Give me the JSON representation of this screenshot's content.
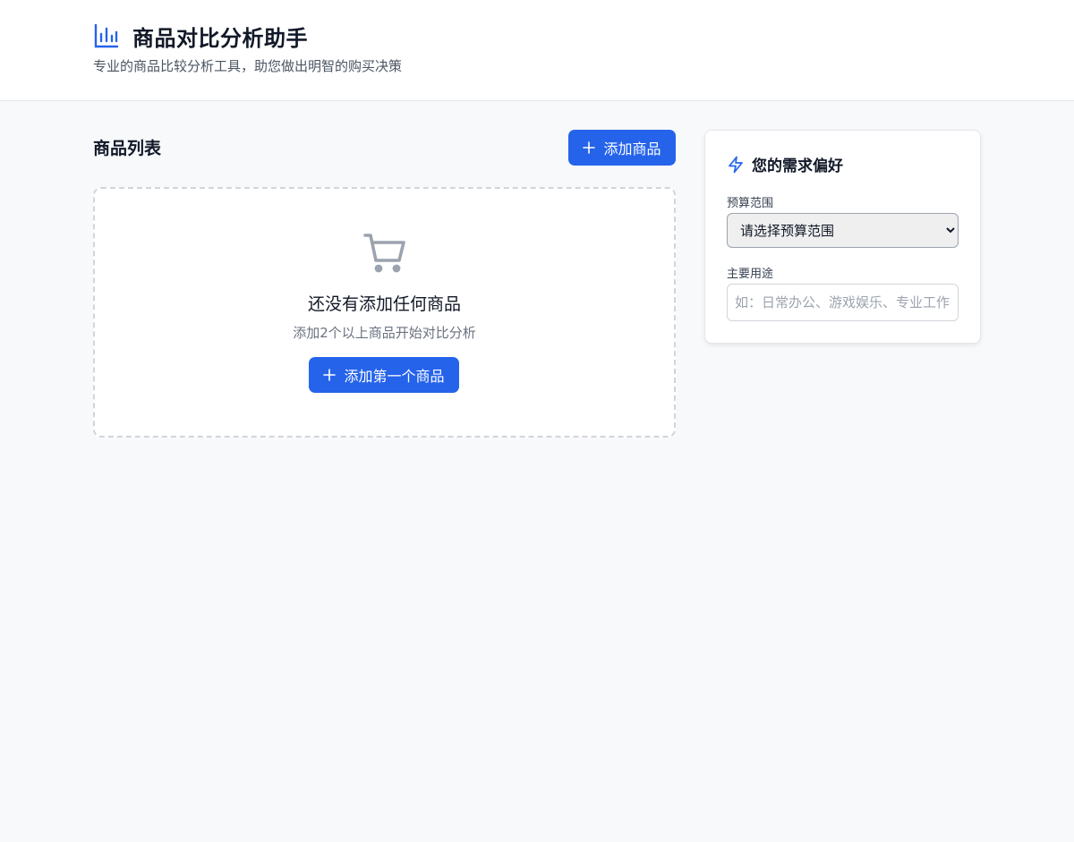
{
  "header": {
    "title": "商品对比分析助手",
    "subtitle": "专业的商品比较分析工具，助您做出明智的购买决策",
    "icon": "bar-chart-icon"
  },
  "products": {
    "section_title": "商品列表",
    "add_button_label": "添加商品",
    "empty_state": {
      "icon": "shopping-cart-icon",
      "title": "还没有添加任何商品",
      "description": "添加2个以上商品开始对比分析",
      "button_label": "添加第一个商品"
    }
  },
  "preferences": {
    "icon": "lightning-bolt-icon",
    "title": "您的需求偏好",
    "budget_label": "预算范围",
    "budget_selected": "请选择预算范围",
    "usage_label": "主要用途",
    "usage_placeholder": "如：日常办公、游戏娱乐、专业工作等",
    "usage_value": ""
  },
  "colors": {
    "accent": "#2563eb",
    "background": "#f8f9fb",
    "muted_icon": "#9ca3af"
  }
}
